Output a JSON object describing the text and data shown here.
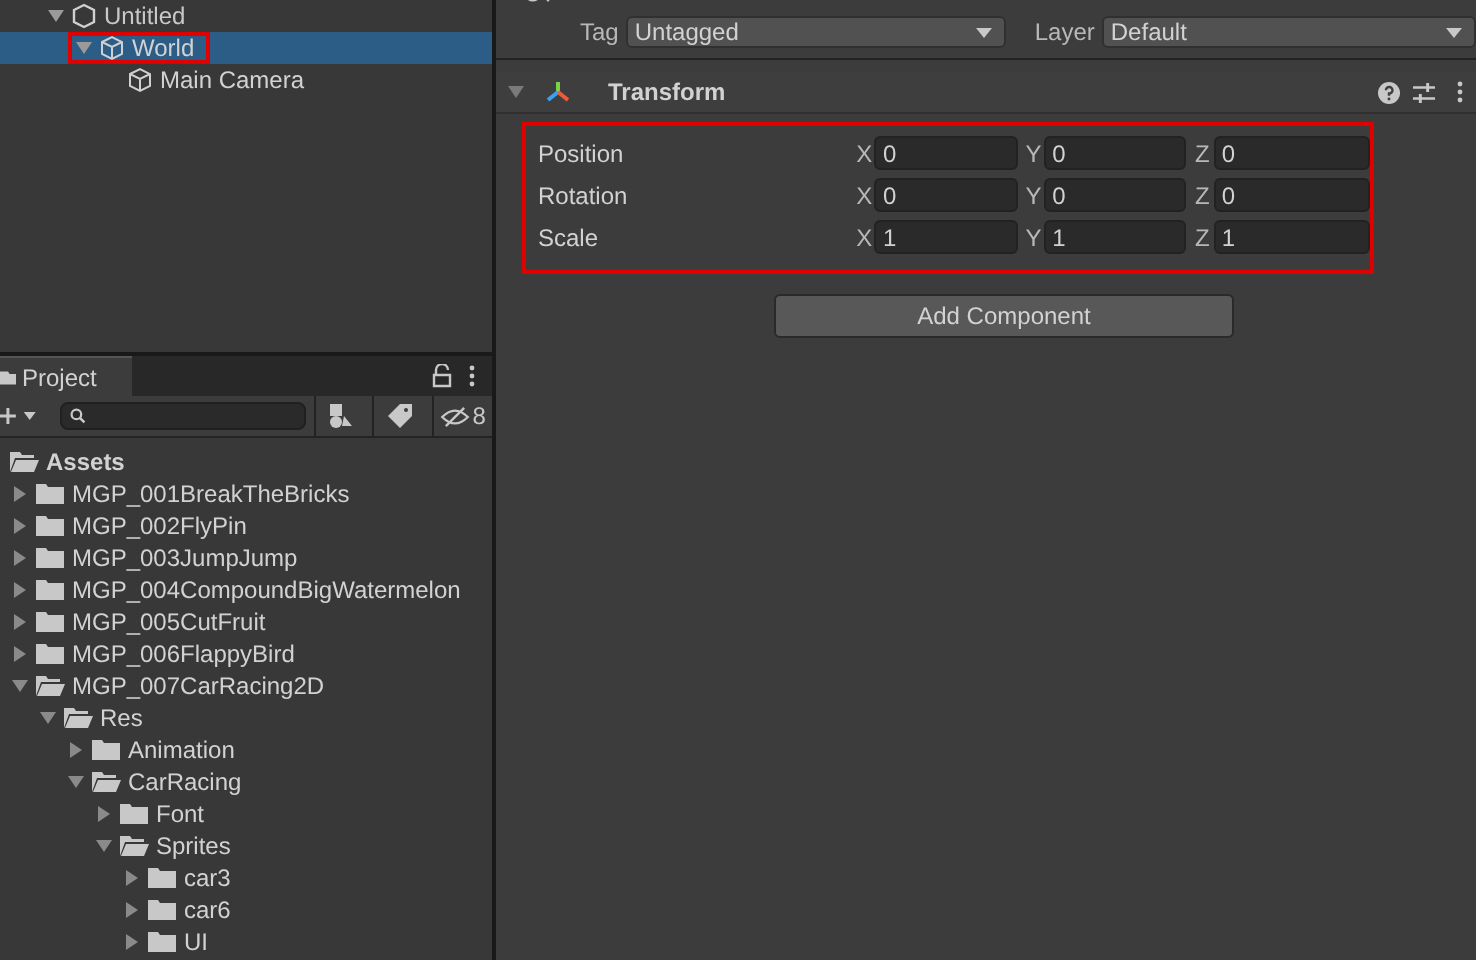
{
  "hierarchy": {
    "items": [
      {
        "name": "Untitled",
        "kind": "scene",
        "expanded": true,
        "selected": false,
        "highlighted": false,
        "children": [
          {
            "name": "World",
            "kind": "object",
            "expanded": true,
            "selected": true,
            "highlighted": true,
            "children": [
              {
                "name": "Main Camera",
                "kind": "object",
                "selected": false,
                "highlighted": false
              }
            ]
          }
        ]
      }
    ]
  },
  "project": {
    "tab": "Project",
    "filter_count": "8",
    "tree": [
      {
        "name": "Assets",
        "expanded": true,
        "children": [
          {
            "name": "MGP_001BreakTheBricks",
            "expanded": false
          },
          {
            "name": "MGP_002FlyPin",
            "expanded": false
          },
          {
            "name": "MGP_003JumpJump",
            "expanded": false
          },
          {
            "name": "MGP_004CompoundBigWatermelon",
            "expanded": false
          },
          {
            "name": "MGP_005CutFruit",
            "expanded": false
          },
          {
            "name": "MGP_006FlappyBird",
            "expanded": false
          },
          {
            "name": "MGP_007CarRacing2D",
            "expanded": true,
            "children": [
              {
                "name": "Res",
                "expanded": true,
                "children": [
                  {
                    "name": "Animation",
                    "expanded": false
                  },
                  {
                    "name": "CarRacing",
                    "expanded": true,
                    "children": [
                      {
                        "name": "Font",
                        "expanded": false
                      },
                      {
                        "name": "Sprites",
                        "expanded": true,
                        "children": [
                          {
                            "name": "car3",
                            "expanded": false
                          },
                          {
                            "name": "car6",
                            "expanded": false
                          },
                          {
                            "name": "UI",
                            "expanded": false
                          }
                        ]
                      }
                    ]
                  }
                ]
              }
            ]
          }
        ]
      }
    ]
  },
  "inspector": {
    "tag_label": "Tag",
    "tag": "Untagged",
    "layer_label": "Layer",
    "layer": "Default",
    "component": {
      "title": "Transform",
      "expanded": true,
      "highlighted": true,
      "rows": [
        {
          "label": "Position",
          "values": [
            {
              "axis": "X",
              "value": "0"
            },
            {
              "axis": "Y",
              "value": "0"
            },
            {
              "axis": "Z",
              "value": "0"
            }
          ]
        },
        {
          "label": "Rotation",
          "values": [
            {
              "axis": "X",
              "value": "0"
            },
            {
              "axis": "Y",
              "value": "0"
            },
            {
              "axis": "Z",
              "value": "0"
            }
          ]
        },
        {
          "label": "Scale",
          "values": [
            {
              "axis": "X",
              "value": "1"
            },
            {
              "axis": "Y",
              "value": "1"
            },
            {
              "axis": "Z",
              "value": "1"
            }
          ]
        }
      ]
    },
    "add_button": "Add Component"
  }
}
